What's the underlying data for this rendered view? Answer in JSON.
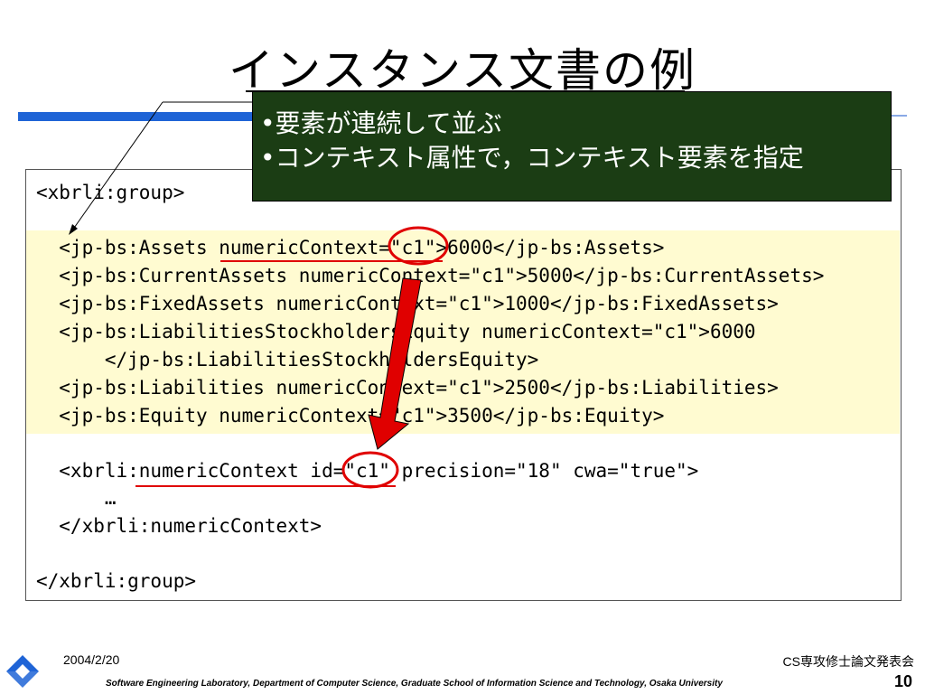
{
  "title": "インスタンス文書の例",
  "callout": {
    "line1": "•要素が連続して並ぶ",
    "line2": "•コンテキスト属性で，コンテキスト要素を指定"
  },
  "code": {
    "group_open": "<xbrli:group>",
    "lines": [
      "  <jp-bs:Assets numericContext=\"c1\">6000</jp-bs:Assets>",
      "  <jp-bs:CurrentAssets numericContext=\"c1\">5000</jp-bs:CurrentAssets>",
      "  <jp-bs:FixedAssets numericContext=\"c1\">1000</jp-bs:FixedAssets>",
      "  <jp-bs:LiabilitiesStockholdersEquity numericContext=\"c1\">6000",
      "      </jp-bs:LiabilitiesStockholdersEquity>",
      "  <jp-bs:Liabilities numericContext=\"c1\">2500</jp-bs:Liabilities>",
      "  <jp-bs:Equity numericContext=\"c1\">3500</jp-bs:Equity>"
    ],
    "context_open": "  <xbrli:numericContext id=\"c1\" precision=\"18\" cwa=\"true\">",
    "ellipsis": "      …",
    "context_close": "  </xbrli:numericContext>",
    "group_close": "</xbrli:group>"
  },
  "footer": {
    "date": "2004/2/20",
    "conference": "CS専攻修士論文発表会",
    "lab": "Software Engineering Laboratory,  Department of Computer Science,  Graduate School of Information Science and Technology,  Osaka University",
    "page": "10"
  },
  "colors": {
    "accent_blue": "#1f64d6",
    "callout_bg": "#1b3d14",
    "highlight_bg": "#fffbd1",
    "annotation_red": "#e00000"
  }
}
